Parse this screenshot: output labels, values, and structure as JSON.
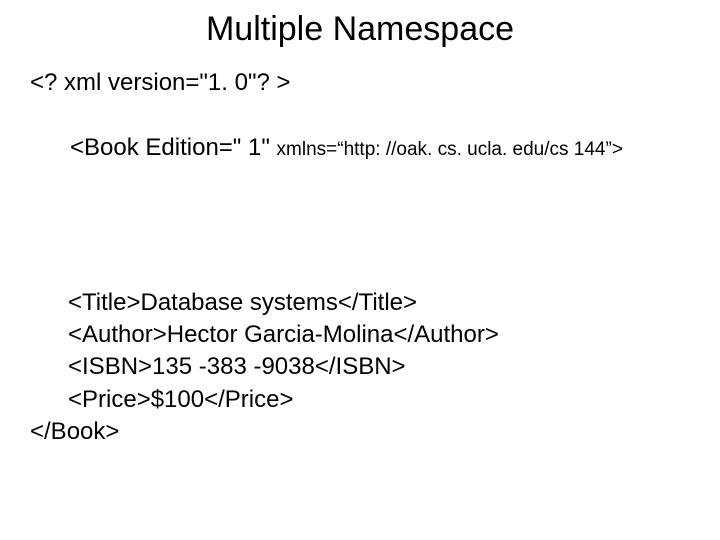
{
  "title": "Multiple Namespace",
  "lines": {
    "l1": "<? xml version=\"1. 0\"? >",
    "l2a": "<Book Edition=\" 1\" ",
    "l2b": "xmlns=“http: //oak. cs. ucla. edu/cs 144”>",
    "l3": "<Title>Database systems</Title>",
    "l4": "<Author>Hector Garcia-Molina</Author>",
    "l5": "<ISBN>135 -383 -9038</ISBN>",
    "l6": "<Price>$100</Price>",
    "l7": "</Book>"
  }
}
